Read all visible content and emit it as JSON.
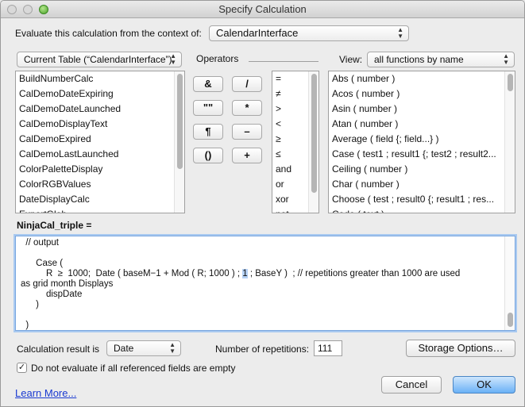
{
  "window": {
    "title": "Specify Calculation"
  },
  "context": {
    "label": "Evaluate this calculation from the context of:",
    "value": "CalendarInterface"
  },
  "table_popup": {
    "value": "Current Table (“CalendarInterface”)"
  },
  "operators": {
    "label": "Operators",
    "buttons": [
      "&",
      "/",
      "\"\"",
      "*",
      "¶",
      "–",
      "()",
      "+"
    ],
    "comparison": [
      "=",
      "≠",
      ">",
      "<",
      "≥",
      "≤",
      "and",
      "or",
      "xor",
      "not"
    ]
  },
  "view": {
    "label": "View:",
    "value": "all functions by name"
  },
  "fields": [
    "BuildNumberCalc",
    "CalDemoDateExpiring",
    "CalDemoDateLaunched",
    "CalDemoDisplayText",
    "CalDemoExpired",
    "CalDemoLastLaunched",
    "ColorPaletteDisplay",
    "ColorRGBValues",
    "DateDisplayCalc",
    "ExportGlob"
  ],
  "functions": [
    "Abs ( number )",
    "Acos ( number )",
    "Asin ( number )",
    "Atan ( number )",
    "Average ( field {; field...} )",
    "Case ( test1 ; result1 {; test2 ; result2...",
    "Ceiling ( number )",
    "Char ( number )",
    "Choose ( test ; result0 {; result1 ; res...",
    "Code ( text )"
  ],
  "calc": {
    "field_name": "NinjaCal_triple =",
    "lines": [
      {
        "text": "  // output"
      },
      {
        "text": ""
      },
      {
        "text": "      Case ("
      },
      {
        "before": "          R  ≥  1000;  Date ( baseM−1 + Mod ( R; 1000 ) ; ",
        "selected": "1",
        "after": " ; BaseY )  ; // repetitions greater than 1000 are used"
      },
      {
        "text": "as grid month Displays"
      },
      {
        "text": "          dispDate"
      },
      {
        "text": "      )"
      },
      {
        "text": ""
      },
      {
        "text": "  )"
      }
    ]
  },
  "result": {
    "label": "Calculation result is",
    "value": "Date"
  },
  "repetitions": {
    "label": "Number of repetitions:",
    "value": "111"
  },
  "storage_button": "Storage Options…",
  "dont_evaluate": {
    "label": "Do not evaluate if all referenced fields are empty",
    "checked": true,
    "mark": "✓"
  },
  "learn_more": "Learn More...",
  "cancel": "Cancel",
  "ok": "OK"
}
